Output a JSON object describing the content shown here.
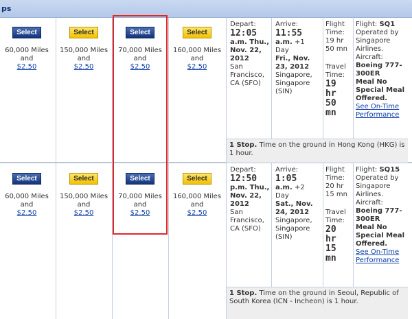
{
  "header": {
    "title": "ps"
  },
  "flights": [
    {
      "fares": [
        {
          "button": "Select",
          "style": "blue",
          "miles": "60,000 Miles",
          "and": "and",
          "price": "$2.50"
        },
        {
          "button": "Select",
          "style": "yellow",
          "miles": "150,000 Miles",
          "and": "and",
          "price": "$2.50"
        },
        {
          "button": "Select",
          "style": "blue",
          "miles": "70,000 Miles",
          "and": "and",
          "price": "$2.50"
        },
        {
          "button": "Select",
          "style": "yellow",
          "miles": "160,000 Miles",
          "and": "and",
          "price": "$2.50"
        }
      ],
      "depart": {
        "label": "Depart:",
        "time1": "12:05",
        "time2": "a.m. Thu.,",
        "date": "Nov. 22, 2012",
        "place": "San Francisco, CA (SFO)"
      },
      "arrive": {
        "label": "Arrive:",
        "time1": "11:55",
        "time2": "a.m.",
        "plus": "+1",
        "day": "Day",
        "date": "Fri., Nov. 23, 2012",
        "place": "Singapore, Singapore (SIN)"
      },
      "flight_time": {
        "label": "Flight Time:",
        "value": "19 hr 50 mn"
      },
      "travel_time": {
        "label": "Travel Time:",
        "value": "19 hr 50 mn"
      },
      "flight": {
        "label": "Flight:",
        "number": "SQ1",
        "operated": "Operated by Singapore Airlines.",
        "aircraft_label": "Aircraft:",
        "aircraft": "Boeing 777-300ER",
        "meal_label": "Meal:",
        "meal": "Meal No Special Meal Offered.",
        "ontime": "See On-Time Performance"
      },
      "stop": {
        "count": "1 Stop.",
        "text": "Time on the ground in Hong Kong (HKG) is 1 hour."
      }
    },
    {
      "fares": [
        {
          "button": "Select",
          "style": "blue",
          "miles": "60,000 Miles",
          "and": "and",
          "price": "$2.50"
        },
        {
          "button": "Select",
          "style": "yellow",
          "miles": "150,000 Miles",
          "and": "and",
          "price": "$2.50"
        },
        {
          "button": "Select",
          "style": "blue",
          "miles": "70,000 Miles",
          "and": "and",
          "price": "$2.50"
        },
        {
          "button": "Select",
          "style": "yellow",
          "miles": "160,000 Miles",
          "and": "and",
          "price": "$2.50"
        }
      ],
      "depart": {
        "label": "Depart:",
        "time1": "12:50",
        "time2": "p.m. Thu.,",
        "date": "Nov. 22, 2012",
        "place": "San Francisco, CA (SFO)"
      },
      "arrive": {
        "label": "Arrive:",
        "time1": "1:05",
        "time2": "a.m.",
        "plus": "+2",
        "day": "Day",
        "date": "Sat., Nov. 24, 2012",
        "place": "Singapore, Singapore (SIN)"
      },
      "flight_time": {
        "label": "Flight Time:",
        "value": "20 hr 15 mn"
      },
      "travel_time": {
        "label": "Travel Time:",
        "value": "20 hr 15 mn"
      },
      "flight": {
        "label": "Flight:",
        "number": "SQ15",
        "operated": "Operated by Singapore Airlines.",
        "aircraft_label": "Aircraft:",
        "aircraft": "Boeing 777-300ER",
        "meal_label": "Meal:",
        "meal": "Meal No Special Meal Offered.",
        "ontime": "See On-Time Performance"
      },
      "stop": {
        "count": "1 Stop.",
        "text": "Time on the ground in Seoul, Republic of South Korea (ICN - Incheon) is 1 hour."
      }
    }
  ]
}
